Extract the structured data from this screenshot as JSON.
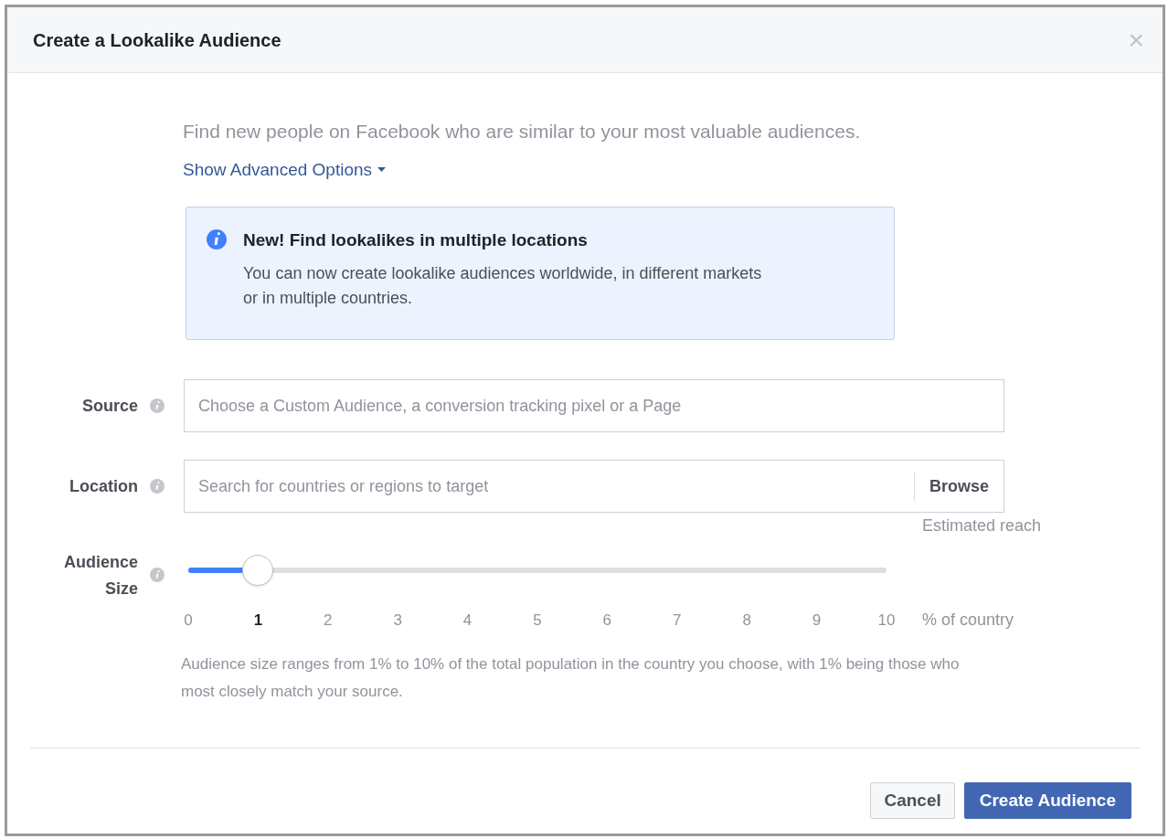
{
  "dialog": {
    "title": "Create a Lookalike Audience",
    "close": "×"
  },
  "intro": "Find new people on Facebook who are similar to your most valuable audiences.",
  "advanced_link": "Show Advanced Options",
  "notice": {
    "title": "New! Find lookalikes in multiple locations",
    "text": "You can now create lookalike audiences worldwide, in different markets or in multiple countries."
  },
  "fields": [
    {
      "kind": "plain",
      "label": "Source",
      "placeholder": "Choose a Custom Audience, a conversion tracking pixel or a Page"
    },
    {
      "kind": "browse",
      "label": "Location",
      "placeholder": "Search for countries or regions to target",
      "button": "Browse"
    }
  ],
  "audience_size": {
    "label": "Audience Size",
    "estimated_reach": "Estimated reach",
    "level": 0.1,
    "unit": "% of country",
    "ticks": [
      {
        "label": "0",
        "selected": false
      },
      {
        "label": "1",
        "selected": true
      },
      {
        "label": "2",
        "selected": false
      },
      {
        "label": "3",
        "selected": false
      },
      {
        "label": "4",
        "selected": false
      },
      {
        "label": "5",
        "selected": false
      },
      {
        "label": "6",
        "selected": false
      },
      {
        "label": "7",
        "selected": false
      },
      {
        "label": "8",
        "selected": false
      },
      {
        "label": "9",
        "selected": false
      },
      {
        "label": "10",
        "selected": false
      }
    ],
    "help": "Audience size ranges from 1% to 10% of the total population in the country you choose, with 1% being those who most closely match your source."
  },
  "buttons": [
    {
      "kind": "secondary",
      "label": "Cancel"
    },
    {
      "kind": "primary",
      "label": "Create Audience"
    }
  ]
}
